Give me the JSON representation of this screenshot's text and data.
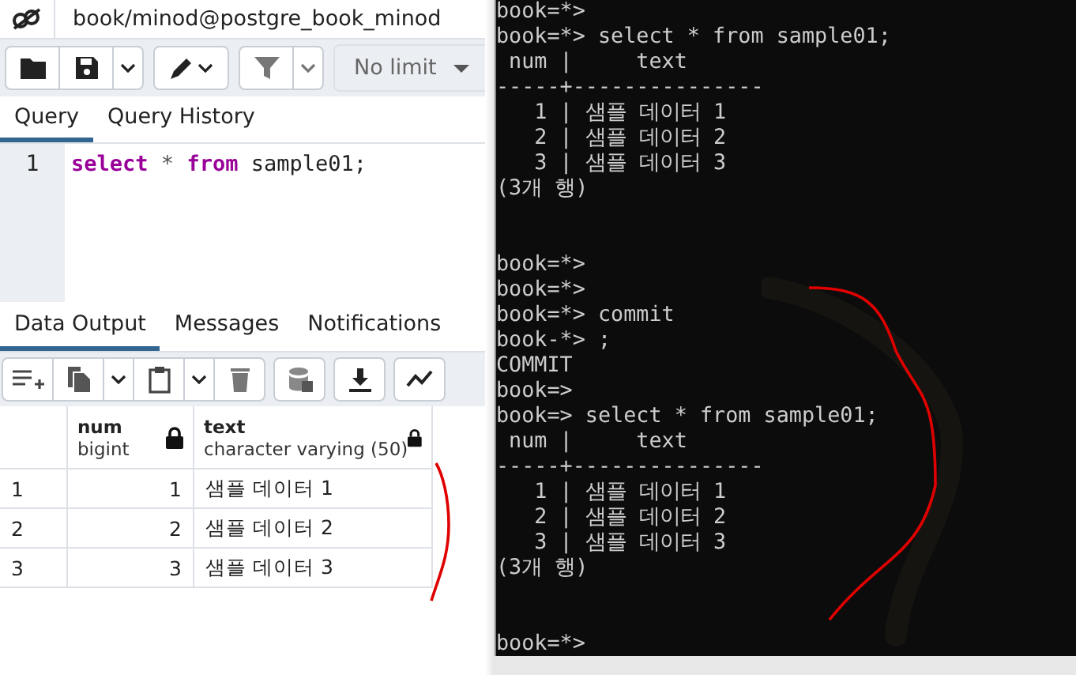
{
  "connection": {
    "label": "book/minod@postgre_book_minod"
  },
  "toolbar": {
    "limit": "No limit"
  },
  "editor_tabs": [
    {
      "label": "Query",
      "selected": true
    },
    {
      "label": "Query History",
      "selected": false
    }
  ],
  "editor": {
    "lines": [
      {
        "number": "1",
        "tokens": [
          {
            "text": "select",
            "kind": "keyword"
          },
          {
            "text": "*",
            "kind": "operator"
          },
          {
            "text": "from",
            "kind": "keyword"
          },
          {
            "text": "sample01;",
            "kind": "plain"
          }
        ]
      }
    ]
  },
  "output_tabs": [
    {
      "label": "Data Output",
      "selected": true
    },
    {
      "label": "Messages",
      "selected": false
    },
    {
      "label": "Notifications",
      "selected": false
    }
  ],
  "table": {
    "columns": [
      {
        "name": "num",
        "type": "bigint",
        "locked": true
      },
      {
        "name": "text",
        "type": "character varying (50)",
        "locked": true
      }
    ],
    "rows": [
      {
        "row": "1",
        "cells": [
          "1",
          "샘플 데이터 1"
        ]
      },
      {
        "row": "2",
        "cells": [
          "2",
          "샘플 데이터 2"
        ]
      },
      {
        "row": "3",
        "cells": [
          "3",
          "샘플 데이터 3"
        ]
      }
    ]
  },
  "terminal": {
    "lines": [
      {
        "kind": "text",
        "text": "book=*>"
      },
      {
        "kind": "text",
        "text": "book=*> select * from sample01;"
      },
      {
        "kind": "text",
        "text": " num |     text"
      },
      {
        "kind": "text",
        "text": "-----+---------------"
      },
      {
        "kind": "text",
        "text": "   1 | 샘플 데이터 1"
      },
      {
        "kind": "text",
        "text": "   2 | 샘플 데이터 2"
      },
      {
        "kind": "text",
        "text": "   3 | 샘플 데이터 3"
      },
      {
        "kind": "text",
        "text": "(3개 행)"
      },
      {
        "kind": "blank"
      },
      {
        "kind": "blank"
      },
      {
        "kind": "text",
        "text": "book=*>"
      },
      {
        "kind": "text",
        "text": "book=*>"
      },
      {
        "kind": "text",
        "text": "book=*> commit"
      },
      {
        "kind": "text",
        "text": "book-*> ;"
      },
      {
        "kind": "text",
        "text": "COMMIT"
      },
      {
        "kind": "text",
        "text": "book=>"
      },
      {
        "kind": "text",
        "text": "book=> select * from sample01;"
      },
      {
        "kind": "text",
        "text": " num |     text"
      },
      {
        "kind": "text",
        "text": "-----+---------------"
      },
      {
        "kind": "text",
        "text": "   1 | 샘플 데이터 1"
      },
      {
        "kind": "text",
        "text": "   2 | 샘플 데이터 2"
      },
      {
        "kind": "text",
        "text": "   3 | 샘플 데이터 3"
      },
      {
        "kind": "text",
        "text": "(3개 행)"
      },
      {
        "kind": "blank"
      },
      {
        "kind": "blank"
      },
      {
        "kind": "text",
        "text": "book=*>"
      }
    ]
  }
}
